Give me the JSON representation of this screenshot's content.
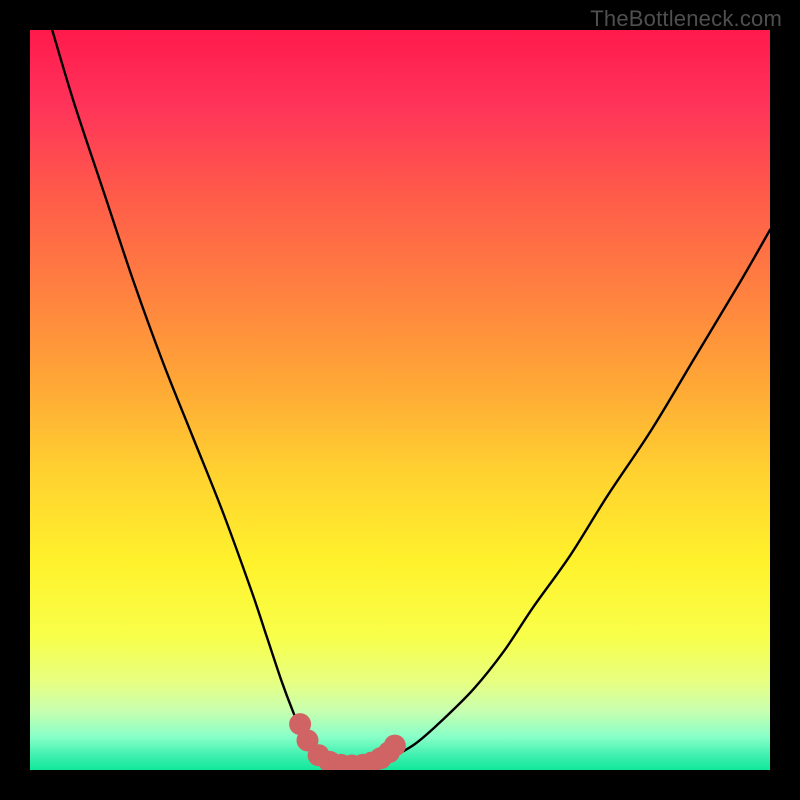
{
  "watermark": "TheBottleneck.com",
  "chart_data": {
    "type": "line",
    "title": "",
    "xlabel": "",
    "ylabel": "",
    "xlim": [
      0,
      100
    ],
    "ylim": [
      0,
      100
    ],
    "curve": {
      "x": [
        3,
        6,
        10,
        14,
        18,
        22,
        26,
        30,
        32,
        34,
        35.5,
        37,
        38.5,
        40,
        42,
        44,
        46,
        48,
        52,
        56,
        60,
        64,
        68,
        73,
        78,
        84,
        90,
        96,
        100
      ],
      "y": [
        100,
        90,
        78,
        66,
        55,
        45,
        35,
        24,
        18,
        12,
        8,
        4.5,
        2.5,
        1.3,
        0.6,
        0.4,
        0.6,
        1.3,
        3.5,
        7,
        11,
        16,
        22,
        29,
        37,
        46,
        56,
        66,
        73
      ]
    },
    "dots": {
      "x": [
        36.5,
        37.5,
        39,
        40.5,
        42,
        43.5,
        45,
        46.2,
        47.4,
        48.5,
        49.3
      ],
      "y": [
        6.2,
        4.0,
        2.0,
        1.1,
        0.7,
        0.6,
        0.7,
        1.0,
        1.6,
        2.4,
        3.3
      ]
    },
    "dot_color": "#d06464",
    "dot_radius": 11,
    "gradient_stops": [
      {
        "offset": 0.0,
        "color": "#ff1a4c"
      },
      {
        "offset": 0.1,
        "color": "#ff335a"
      },
      {
        "offset": 0.22,
        "color": "#ff5a4a"
      },
      {
        "offset": 0.35,
        "color": "#ff8040"
      },
      {
        "offset": 0.48,
        "color": "#ffa836"
      },
      {
        "offset": 0.6,
        "color": "#ffd230"
      },
      {
        "offset": 0.72,
        "color": "#fff22c"
      },
      {
        "offset": 0.82,
        "color": "#f8ff4a"
      },
      {
        "offset": 0.88,
        "color": "#e8ff80"
      },
      {
        "offset": 0.92,
        "color": "#c8ffb0"
      },
      {
        "offset": 0.955,
        "color": "#88ffc8"
      },
      {
        "offset": 0.98,
        "color": "#40f0b0"
      },
      {
        "offset": 1.0,
        "color": "#10e89a"
      }
    ]
  }
}
